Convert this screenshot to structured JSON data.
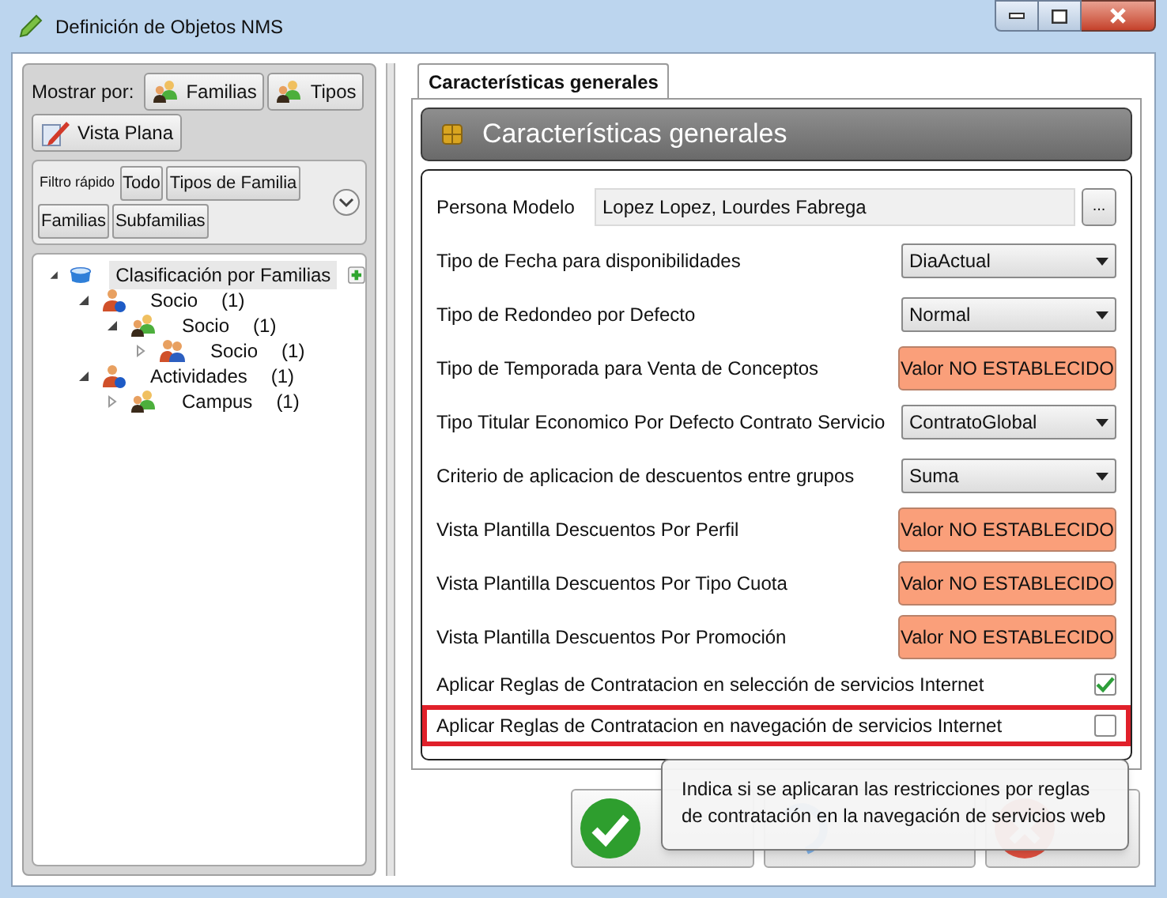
{
  "window": {
    "title": "Definición de Objetos NMS"
  },
  "sidebar": {
    "show_by_label": "Mostrar por:",
    "show_by_buttons": [
      {
        "label": "Familias",
        "kind": "group"
      },
      {
        "label": "Tipos",
        "kind": "group"
      },
      {
        "label": "Vista Plana",
        "kind": "flat"
      }
    ],
    "quick_filter": {
      "label": "Filtro rápido",
      "buttons": [
        "Todo",
        "Tipos de Familia",
        "Familias",
        "Subfamilias"
      ]
    },
    "tree": [
      {
        "label": "Clasificación por Familias",
        "kind": "root",
        "expanded": true,
        "selected": true,
        "children": [
          {
            "label": "Socio",
            "count": "(1)",
            "kind": "category",
            "expanded": true,
            "selected": false,
            "children": [
              {
                "label": "Socio",
                "count": "(1)",
                "kind": "group",
                "expanded": true,
                "selected": false,
                "children": [
                  {
                    "label": "Socio",
                    "count": "(1)",
                    "kind": "type",
                    "expanded": false,
                    "selected": false
                  }
                ]
              }
            ]
          },
          {
            "label": "Actividades",
            "count": "(1)",
            "kind": "category",
            "expanded": true,
            "selected": false,
            "children": [
              {
                "label": "Campus",
                "count": "(1)",
                "kind": "group",
                "expanded": false,
                "selected": false
              }
            ]
          }
        ]
      }
    ]
  },
  "tabs": [
    {
      "label": "Características generales",
      "selected": true
    }
  ],
  "section_header": "Características generales",
  "fields": [
    {
      "label": "Persona Modelo",
      "kind": "picker",
      "value": "Lopez Lopez, Lourdes Fabrega",
      "button": "...",
      "highlighted": false
    },
    {
      "label": "Tipo de Fecha para disponibilidades",
      "kind": "dropdown",
      "value": "DiaActual",
      "highlighted": false
    },
    {
      "label": "Tipo de Redondeo por Defecto",
      "kind": "dropdown",
      "value": "Normal",
      "highlighted": false
    },
    {
      "label": "Tipo de Temporada para Venta de Conceptos",
      "kind": "unset",
      "value": "Valor NO ESTABLECIDO",
      "highlighted": false
    },
    {
      "label": "Tipo Titular Economico Por Defecto Contrato Servicio",
      "kind": "dropdown",
      "value": "ContratoGlobal",
      "highlighted": false
    },
    {
      "label": "Criterio de aplicacion de descuentos entre grupos",
      "kind": "dropdown",
      "value": "Suma",
      "highlighted": false
    },
    {
      "label": "Vista Plantilla Descuentos Por Perfil",
      "kind": "unset",
      "value": "Valor NO ESTABLECIDO",
      "highlighted": false
    },
    {
      "label": "Vista Plantilla Descuentos Por Tipo Cuota",
      "kind": "unset",
      "value": "Valor NO ESTABLECIDO",
      "highlighted": false
    },
    {
      "label": "Vista Plantilla Descuentos Por Promoción",
      "kind": "unset",
      "value": "Valor NO ESTABLECIDO",
      "highlighted": false
    },
    {
      "label": "Aplicar Reglas de Contratacion en selección de servicios Internet",
      "kind": "checkbox",
      "checked": true,
      "highlighted": false
    },
    {
      "label": "Aplicar Reglas de Contratacion en navegación de servicios Internet",
      "kind": "checkbox",
      "checked": false,
      "highlighted": true
    }
  ],
  "buttons": [
    {
      "kind": "validate"
    },
    {
      "kind": "discard"
    },
    {
      "kind": "exit"
    }
  ],
  "tooltip": "Indica si se aplicaran las restricciones por reglas de contratación en la navegación de servicios web"
}
